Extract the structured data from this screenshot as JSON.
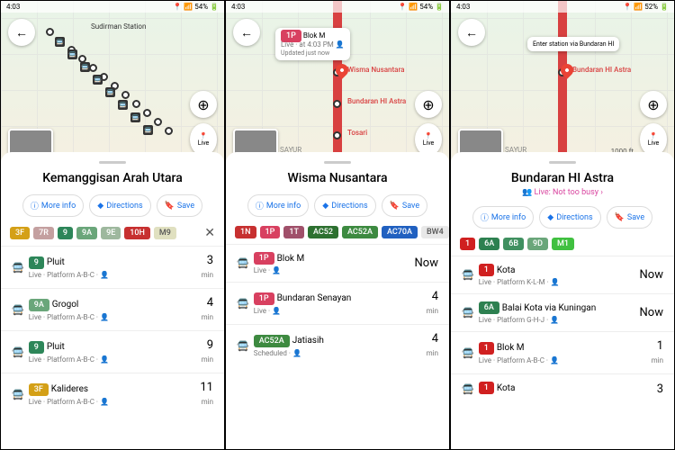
{
  "panels": [
    {
      "time": "4:03",
      "signal": "📶 54%",
      "title": "Kemanggisan Arah Utara",
      "maplabel": "Sudirman Station",
      "routes": [
        {
          "t": "3F",
          "c": "#d4a017"
        },
        {
          "t": "7R",
          "c": "#c4a0a0"
        },
        {
          "t": "9",
          "c": "#2d8659"
        },
        {
          "t": "9A",
          "c": "#6aa67a"
        },
        {
          "t": "9E",
          "c": "#9eb89e"
        },
        {
          "t": "10H",
          "c": "#c73030"
        },
        {
          "t": "M9",
          "c": "#e0e0c0",
          "fg": "#555"
        }
      ],
      "closable": true,
      "deps": [
        {
          "chip": {
            "t": "9",
            "c": "#2d8659"
          },
          "dest": "Pluit",
          "sub": "Live · Platform A-B-C · 👤",
          "eta": "3",
          "unit": "min"
        },
        {
          "chip": {
            "t": "9A",
            "c": "#6aa67a"
          },
          "dest": "Grogol",
          "sub": "Live · Platform A-B-C · 👤",
          "eta": "4",
          "unit": "min"
        },
        {
          "chip": {
            "t": "9",
            "c": "#2d8659"
          },
          "dest": "Pluit",
          "sub": "Live · Platform A-B-C · 👤",
          "eta": "9",
          "unit": "min"
        },
        {
          "chip": {
            "t": "3F",
            "c": "#d4a017"
          },
          "dest": "Kalideres",
          "sub": "Live · Platform A-B-C · 👤",
          "eta": "11",
          "unit": "min"
        }
      ]
    },
    {
      "time": "4:03",
      "signal": "📶 54%",
      "title": "Wisma Nusantara",
      "popup": {
        "chip": {
          "t": "1P",
          "c": "#d84060"
        },
        "dest": "Blok M",
        "sub": "Live · at 4:03 PM 👤",
        "sub2": "Updated just now"
      },
      "places": [
        "Wisma Nusantara",
        "Bundaran HI Astra",
        "Tosari"
      ],
      "sayur": "SAYUR",
      "routes": [
        {
          "t": "1N",
          "c": "#c73030"
        },
        {
          "t": "1P",
          "c": "#d84060"
        },
        {
          "t": "1T",
          "c": "#a0506a"
        },
        {
          "t": "AC52",
          "c": "#2d7030"
        },
        {
          "t": "AC52A",
          "c": "#3d8a40"
        },
        {
          "t": "AC70A",
          "c": "#2060c0"
        },
        {
          "t": "BW4",
          "c": "#e8e8e8",
          "fg": "#555"
        }
      ],
      "deps": [
        {
          "chip": {
            "t": "1P",
            "c": "#d84060"
          },
          "dest": "Blok M",
          "sub": "Live · 👤",
          "eta": "Now",
          "unit": ""
        },
        {
          "chip": {
            "t": "1P",
            "c": "#d84060"
          },
          "dest": "Bundaran Senayan",
          "sub": "Live · 👤",
          "eta": "4",
          "unit": "min"
        },
        {
          "chip": {
            "t": "AC52A",
            "c": "#3d8a40"
          },
          "dest": "Jatiasih",
          "sub": "Scheduled · 👤",
          "eta": "4",
          "unit": "min"
        }
      ]
    },
    {
      "time": "4:03",
      "signal": "📶 52%",
      "title": "Bundaran HI Astra",
      "enter": "Enter station\nvia Bundaran HI",
      "places": [
        "Bundaran HI Astra"
      ],
      "sayur": "SAYUR",
      "scale": "1000 ft",
      "live": "👥 Live: Not too busy ›",
      "routes": [
        {
          "t": "1",
          "c": "#d02020"
        },
        {
          "t": "6A",
          "c": "#2d8050"
        },
        {
          "t": "6B",
          "c": "#409060"
        },
        {
          "t": "9D",
          "c": "#6aa67a"
        },
        {
          "t": "M1",
          "c": "#40c040"
        }
      ],
      "deps": [
        {
          "chip": {
            "t": "1",
            "c": "#d02020"
          },
          "dest": "Kota",
          "sub": "Live · Platform K-L-M · 👤",
          "eta": "Now",
          "unit": ""
        },
        {
          "chip": {
            "t": "6A",
            "c": "#2d8050"
          },
          "dest": "Balai Kota via Kuningan",
          "sub": "Live · Platform G-H-J · 👤",
          "eta": "Now",
          "unit": ""
        },
        {
          "chip": {
            "t": "1",
            "c": "#d02020"
          },
          "dest": "Blok M",
          "sub": "Live · Platform A-B-C · 👤",
          "eta": "1",
          "unit": "min"
        },
        {
          "chip": {
            "t": "1",
            "c": "#d02020"
          },
          "dest": "Kota",
          "sub": "",
          "eta": "3",
          "unit": ""
        }
      ]
    }
  ],
  "ui": {
    "more": "More info",
    "dir": "Directions",
    "save": "Save",
    "live": "Live"
  }
}
